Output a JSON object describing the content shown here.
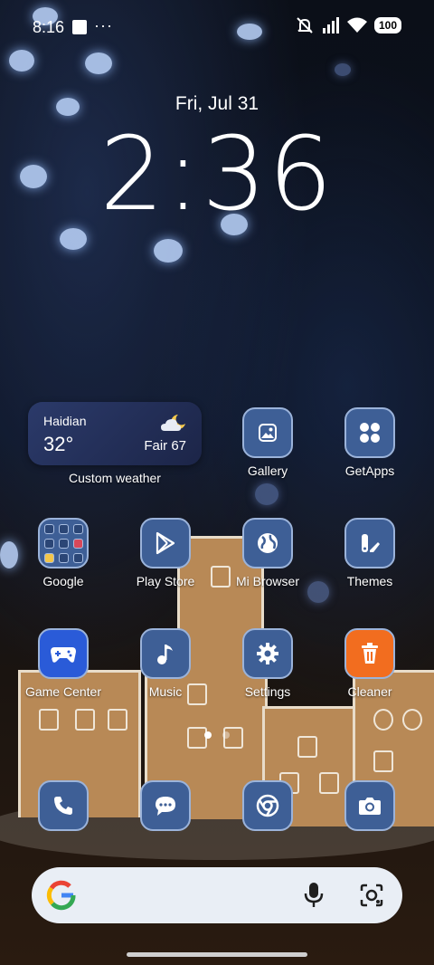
{
  "status_bar": {
    "time": "8:16",
    "more": "···",
    "battery": "100"
  },
  "lockscreen": {
    "date": "Fri, Jul 31",
    "clock": "2:36"
  },
  "weather_widget": {
    "city": "Haidian",
    "temperature": "32°",
    "condition": "Fair 67",
    "label": "Custom weather"
  },
  "apps": {
    "gallery": "Gallery",
    "getapps": "GetApps",
    "google": "Google",
    "play_store": "Play Store",
    "mi_browser": "Mi Browser",
    "themes": "Themes",
    "game_center": "Game Center",
    "music": "Music",
    "settings": "Settings",
    "cleaner": "Cleaner"
  },
  "dock": [
    "phone-icon",
    "messages-icon",
    "chrome-icon",
    "camera-icon"
  ],
  "pager": {
    "pages": 2,
    "current": 1
  },
  "colors": {
    "tile": "#3e5f96",
    "tile_border": "#9bb3da",
    "cleaner": "#f26d1f",
    "search_bar": "#e9eef5"
  }
}
